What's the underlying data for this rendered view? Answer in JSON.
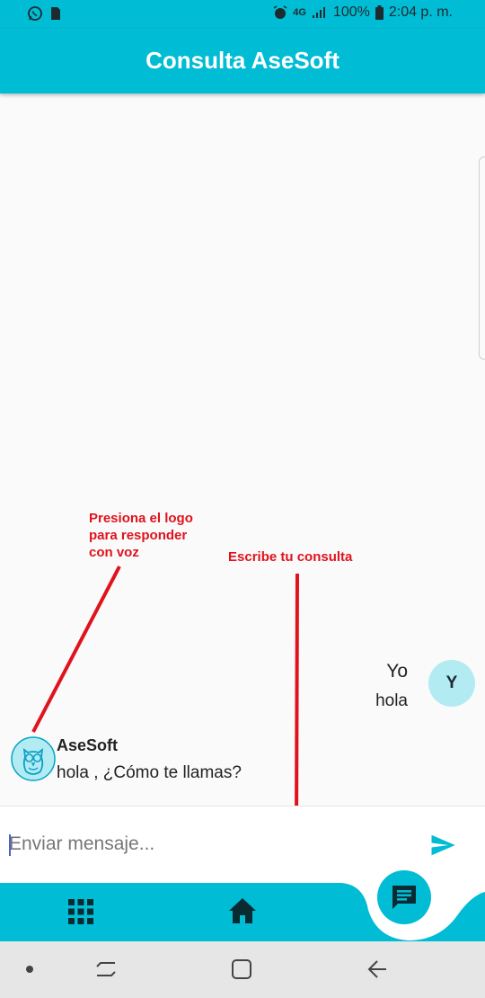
{
  "status_bar": {
    "battery_percent": "100%",
    "time": "2:04 p. m.",
    "icons_left": [
      "whatsapp-icon",
      "sim-icon"
    ],
    "icons_right": [
      "alarm-icon",
      "data-4g-icon",
      "signal-icon",
      "battery-icon"
    ]
  },
  "app_bar": {
    "title": "Consulta AseSoft"
  },
  "annotations": {
    "logo_hint_lines": [
      "Presiona el logo",
      "para responder",
      "con voz"
    ],
    "input_hint": "Escribe tu consulta"
  },
  "messages": [
    {
      "sender": "Yo",
      "avatar_initial": "Y",
      "text": "hola",
      "side": "right"
    },
    {
      "sender": "AseSoft",
      "avatar": "owl-logo-icon",
      "text": "hola , ¿Cómo te llamas?",
      "side": "left"
    }
  ],
  "input": {
    "placeholder": "Enviar mensaje...",
    "value": ""
  },
  "bottom_nav": {
    "items": [
      "grid-icon",
      "home-icon",
      "chat-icon"
    ]
  },
  "system_nav": {
    "items": [
      "dot-icon",
      "recents-icon",
      "home-square-icon",
      "back-icon"
    ]
  },
  "colors": {
    "primary": "#00bcd4",
    "annotation": "#e0131d",
    "avatar_bg": "#b3ebf2",
    "background": "#fafafa"
  }
}
